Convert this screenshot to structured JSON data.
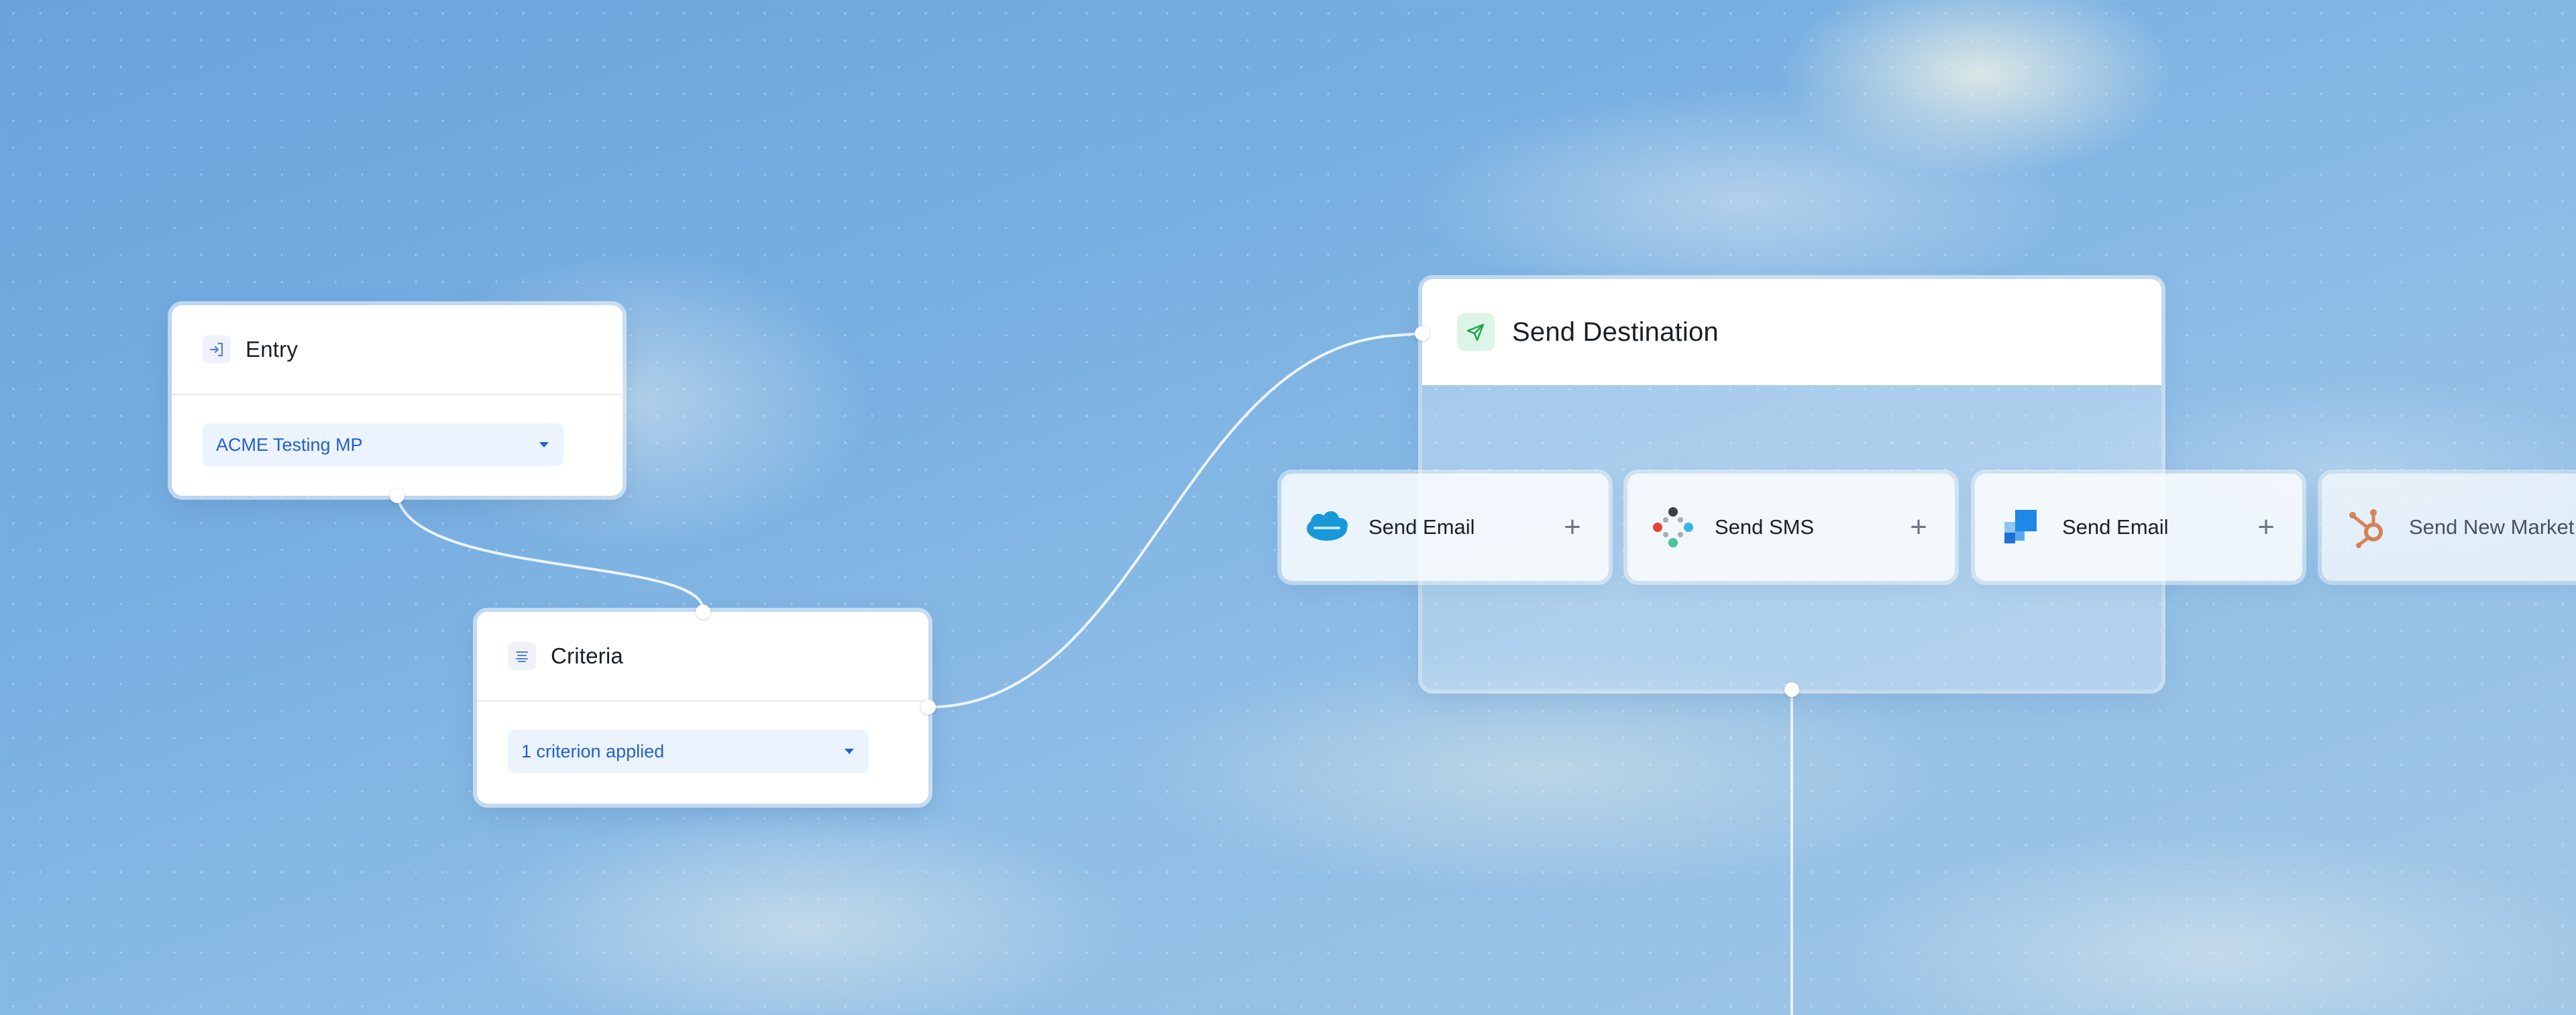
{
  "canvas": {
    "accent_color": "#2460c9",
    "background_color": "#79b0e2"
  },
  "entry_node": {
    "title": "Entry",
    "icon": "entry-arrow-icon",
    "select_value": "ACME Testing MP"
  },
  "criteria_node": {
    "title": "Criteria",
    "icon": "list-filter-icon",
    "select_value": "1 criterion applied"
  },
  "destination_node": {
    "title": "Send Destination",
    "icon": "paper-plane-icon",
    "icon_color": "#17a34a",
    "actions": [
      {
        "label": "Send Email",
        "logo": "salesforce-logo"
      },
      {
        "label": "Send SMS",
        "logo": "segment-dots-logo"
      },
      {
        "label": "Send Email",
        "logo": "blue-squares-logo"
      },
      {
        "label": "Send New Market",
        "logo": "hubspot-logo"
      }
    ]
  }
}
